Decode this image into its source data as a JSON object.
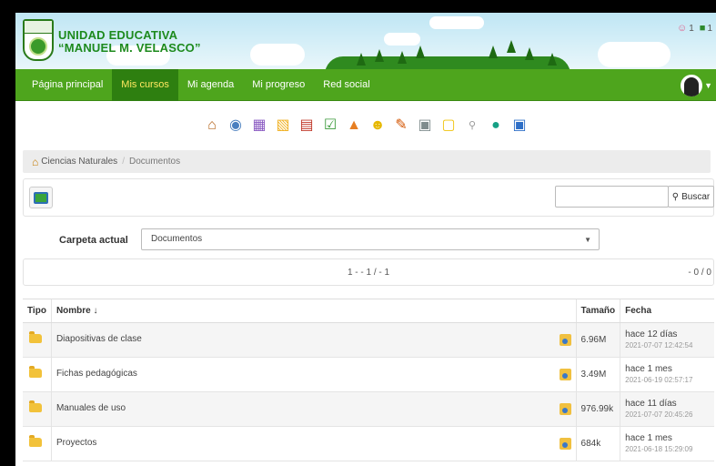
{
  "header": {
    "school_line1": "UNIDAD EDUCATIVA",
    "school_line2": "“MANUEL M. VELASCO”",
    "users_online_count": "1",
    "messages_count": "1"
  },
  "nav": {
    "items": [
      {
        "label": "Página principal"
      },
      {
        "label": "Mis cursos"
      },
      {
        "label": "Mi agenda"
      },
      {
        "label": "Mi progreso"
      },
      {
        "label": "Red social"
      }
    ],
    "active_index": 1
  },
  "toolbar": {
    "icons": [
      "home-icon",
      "graduation-cap-icon",
      "calendar-icon",
      "folder-icon",
      "books-icon",
      "checklist-icon",
      "bell-icon",
      "smiley-icon",
      "pencil-icon",
      "calculator-icon",
      "note-icon",
      "search-small-icon",
      "chat-bubble-icon",
      "edit-icon"
    ]
  },
  "breadcrumb": {
    "course": "Ciencias Naturales",
    "separator": "/",
    "current": "Documentos"
  },
  "actions": {
    "search_value": "",
    "search_button_label": "Buscar"
  },
  "folder": {
    "label": "Carpeta actual",
    "selected": "Documentos"
  },
  "pager": {
    "center": "1 - - 1 / - 1",
    "right": "- 0 / 0"
  },
  "table": {
    "headers": {
      "type": "Tipo",
      "name": "Nombre ↓",
      "size": "Tamaño",
      "date": "Fecha"
    },
    "rows": [
      {
        "name": "Diapositivas de clase",
        "size": "6.96M",
        "date": "hace 12 días",
        "date_exact": "2021-07-07 12:42:54"
      },
      {
        "name": "Fichas pedagógicas",
        "size": "3.49M",
        "date": "hace 1 mes",
        "date_exact": "2021-06-19 02:57:17"
      },
      {
        "name": "Manuales de uso",
        "size": "976.99k",
        "date": "hace 11 días",
        "date_exact": "2021-07-07 20:45:26"
      },
      {
        "name": "Proyectos",
        "size": "684k",
        "date": "hace 1 mes",
        "date_exact": "2021-06-18 15:29:09"
      }
    ]
  },
  "colors": {
    "nav_green": "#4ea51d",
    "nav_active": "#2e7f10",
    "nav_active_text": "#ffe860",
    "title_green": "#1d8a1d"
  }
}
